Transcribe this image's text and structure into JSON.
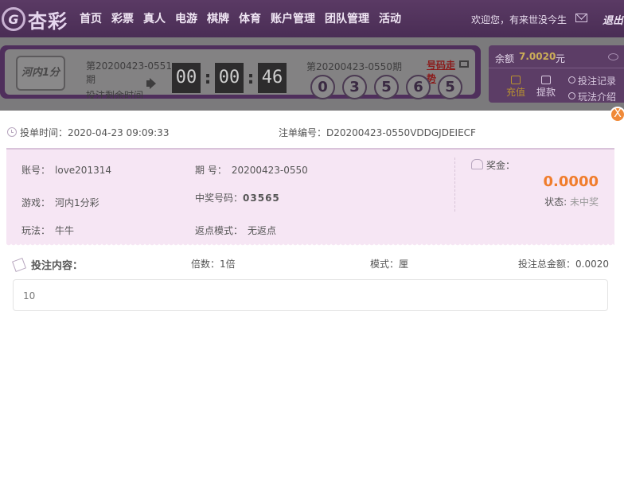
{
  "header": {
    "logo_text": "杏彩",
    "logo_mark": "G",
    "nav": [
      "首页",
      "彩票",
      "真人",
      "电游",
      "棋牌",
      "体育",
      "账户管理",
      "团队管理",
      "活动"
    ],
    "welcome": "欢迎您，有来世没今生",
    "logout": "退出"
  },
  "lottery": {
    "logo_text": "河内1分",
    "current_issue": "第20200423-0551期",
    "countdown_label": "投注剩余时间",
    "countdown": {
      "h": "00",
      "m": "00",
      "s": "46"
    },
    "last_issue": "第20200423-0550期",
    "trend_link": "号码走势",
    "balls": [
      "0",
      "3",
      "5",
      "6",
      "5"
    ]
  },
  "wallet": {
    "balance_label": "余额",
    "balance": "7.0020",
    "unit": "元",
    "recharge": "充值",
    "withdraw": "提款",
    "bet_record": "投注记录",
    "rules": "玩法介绍"
  },
  "detail": {
    "close": "X",
    "bet_time": "投单时间：2020-04-23 09:09:33",
    "order_no": "注单编号：D20200423-0550VDDGJDEIECF",
    "account_label": "账号：",
    "account": "love201314",
    "issue_label": "期 号：",
    "issue": "20200423-0550",
    "game_label": "游戏：",
    "game": "河内1分彩",
    "win_numbers_label": "中奖号码：",
    "win_numbers": "03565",
    "play_label": "玩法：",
    "play": "牛牛",
    "rebate_label": "返点模式：",
    "rebate": "无返点",
    "prize_label": "奖金：",
    "prize": "0.0000",
    "status_label": "状态:",
    "status": "未中奖",
    "content_title": "投注内容：",
    "multiple": "倍数：1倍",
    "mode": "模式：厘",
    "total": "投注总金额：0.0020",
    "content": "10"
  }
}
